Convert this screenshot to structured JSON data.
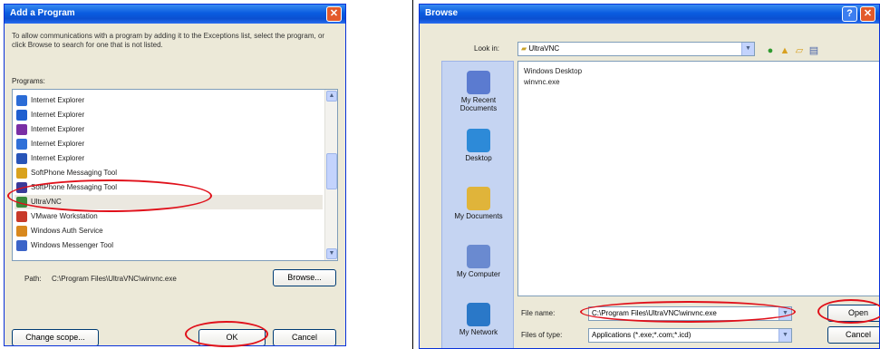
{
  "add_program": {
    "title": "Add a Program",
    "description": "To allow communications with a program by adding it to the Exceptions list, select the program, or click Browse to search for one that is not listed.",
    "programs_label": "Programs:",
    "programs": [
      {
        "label": "Internet Explorer",
        "icon": "globe-icon",
        "color": "#2b6cd6"
      },
      {
        "label": "Internet Explorer",
        "icon": "ie-icon",
        "color": "#1f5fd0"
      },
      {
        "label": "Internet Explorer",
        "icon": "ie-icon",
        "color": "#7a2fa5"
      },
      {
        "label": "Internet Explorer",
        "icon": "ie-icon",
        "color": "#3070d8"
      },
      {
        "label": "Internet Explorer",
        "icon": "ie-icon",
        "color": "#2855b8"
      },
      {
        "label": "SoftPhone Messaging Tool",
        "icon": "tool-icon",
        "color": "#d9a21d"
      },
      {
        "label": "SoftPhone Messaging Tool",
        "icon": "app-icon",
        "color": "#3a3a9a"
      },
      {
        "label": "UltraVNC",
        "icon": "vnc-icon",
        "color": "#3a8a3a"
      },
      {
        "label": "VMware Workstation",
        "icon": "vmware-icon",
        "color": "#c83a2a"
      },
      {
        "label": "Windows Auth Service",
        "icon": "windows-icon",
        "color": "#d8881d"
      },
      {
        "label": "Windows Messenger Tool",
        "icon": "messenger-icon",
        "color": "#3b64c8"
      }
    ],
    "selected_index": 7,
    "path_label": "Path:",
    "path_value": "C:\\Program Files\\UltraVNC\\winvnc.exe",
    "browse_label": "Browse...",
    "change_scope_label": "Change scope...",
    "ok_label": "OK",
    "cancel_label": "Cancel"
  },
  "browse": {
    "title": "Browse",
    "look_in_label": "Look in:",
    "look_in_value": "UltraVNC",
    "places": [
      {
        "label": "My Recent Documents",
        "icon": "recent-documents-icon"
      },
      {
        "label": "Desktop",
        "icon": "desktop-icon"
      },
      {
        "label": "My Documents",
        "icon": "my-documents-icon"
      },
      {
        "label": "My Computer",
        "icon": "my-computer-icon"
      },
      {
        "label": "My Network",
        "icon": "my-network-icon"
      }
    ],
    "files": [
      "Windows Desktop",
      "winvnc.exe"
    ],
    "file_name_label": "File name:",
    "file_name_value": "C:\\Program Files\\UltraVNC\\winvnc.exe",
    "files_of_type_label": "Files of type:",
    "files_of_type_value": "Applications (*.exe;*.com;*.icd)",
    "open_label": "Open",
    "cancel_label": "Cancel"
  },
  "colors": {
    "title_bar": "#0a5ce0",
    "dialog_bg": "#ece9d8",
    "highlight": "#e0101a"
  }
}
